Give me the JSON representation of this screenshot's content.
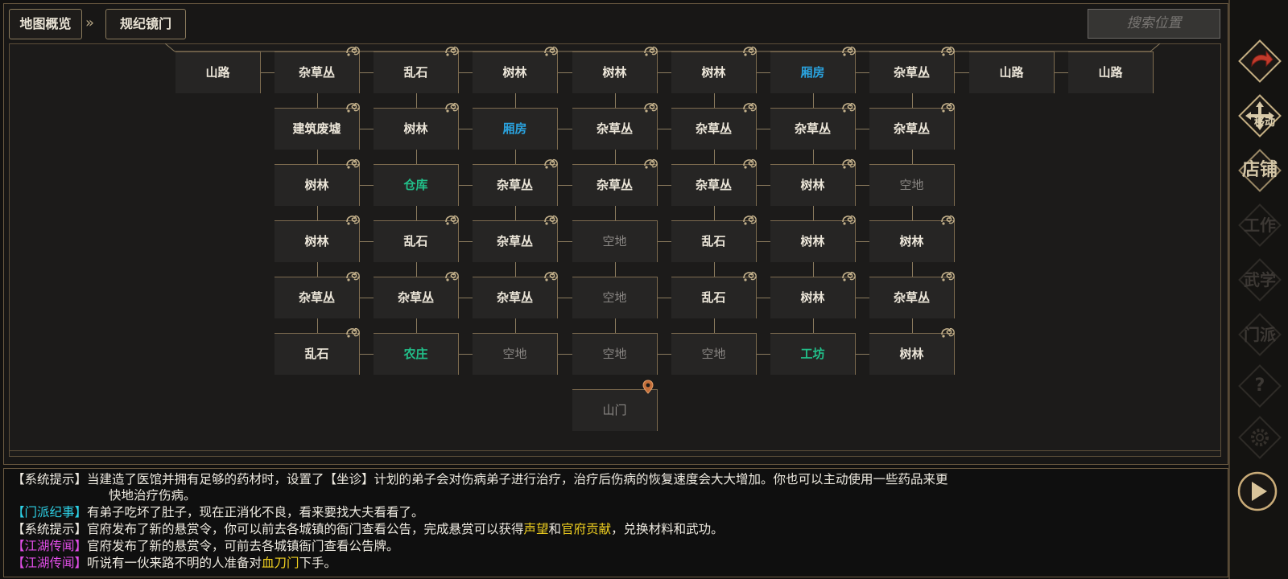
{
  "breadcrumb": {
    "root": "地图概览",
    "separator": "»",
    "current": "规纪镜门"
  },
  "search": {
    "placeholder": "搜索位置"
  },
  "map": {
    "rows": [
      [
        {
          "label": "山路",
          "type": "normal",
          "badge": false
        },
        {
          "label": "杂草丛",
          "type": "normal",
          "badge": true
        },
        {
          "label": "乱石",
          "type": "normal",
          "badge": true
        },
        {
          "label": "树林",
          "type": "normal",
          "badge": true
        },
        {
          "label": "树林",
          "type": "normal",
          "badge": true
        },
        {
          "label": "树林",
          "type": "normal",
          "badge": true
        },
        {
          "label": "厢房",
          "type": "blue",
          "badge": true
        },
        {
          "label": "杂草丛",
          "type": "normal",
          "badge": true
        },
        {
          "label": "山路",
          "type": "normal",
          "badge": false
        },
        {
          "label": "山路",
          "type": "normal",
          "badge": false
        }
      ],
      [
        {
          "label": "建筑废墟",
          "type": "normal",
          "badge": true
        },
        {
          "label": "树林",
          "type": "normal",
          "badge": true
        },
        {
          "label": "厢房",
          "type": "blue",
          "badge": false
        },
        {
          "label": "杂草丛",
          "type": "normal",
          "badge": true
        },
        {
          "label": "杂草丛",
          "type": "normal",
          "badge": true
        },
        {
          "label": "杂草丛",
          "type": "normal",
          "badge": true
        },
        {
          "label": "杂草丛",
          "type": "normal",
          "badge": true
        }
      ],
      [
        {
          "label": "树林",
          "type": "normal",
          "badge": true
        },
        {
          "label": "仓库",
          "type": "green",
          "badge": false
        },
        {
          "label": "杂草丛",
          "type": "normal",
          "badge": true
        },
        {
          "label": "杂草丛",
          "type": "normal",
          "badge": true
        },
        {
          "label": "杂草丛",
          "type": "normal",
          "badge": true
        },
        {
          "label": "树林",
          "type": "normal",
          "badge": true
        },
        {
          "label": "空地",
          "type": "empty",
          "badge": false
        }
      ],
      [
        {
          "label": "树林",
          "type": "normal",
          "badge": true
        },
        {
          "label": "乱石",
          "type": "normal",
          "badge": true
        },
        {
          "label": "杂草丛",
          "type": "normal",
          "badge": true
        },
        {
          "label": "空地",
          "type": "empty",
          "badge": false
        },
        {
          "label": "乱石",
          "type": "normal",
          "badge": true
        },
        {
          "label": "树林",
          "type": "normal",
          "badge": true
        },
        {
          "label": "树林",
          "type": "normal",
          "badge": true
        }
      ],
      [
        {
          "label": "杂草丛",
          "type": "normal",
          "badge": true
        },
        {
          "label": "杂草丛",
          "type": "normal",
          "badge": true
        },
        {
          "label": "杂草丛",
          "type": "normal",
          "badge": true
        },
        {
          "label": "空地",
          "type": "empty",
          "badge": false
        },
        {
          "label": "乱石",
          "type": "normal",
          "badge": true
        },
        {
          "label": "树林",
          "type": "normal",
          "badge": true
        },
        {
          "label": "杂草丛",
          "type": "normal",
          "badge": true
        }
      ],
      [
        {
          "label": "乱石",
          "type": "normal",
          "badge": true
        },
        {
          "label": "农庄",
          "type": "green",
          "badge": false
        },
        {
          "label": "空地",
          "type": "empty",
          "badge": false
        },
        {
          "label": "空地",
          "type": "empty",
          "badge": false
        },
        {
          "label": "空地",
          "type": "empty",
          "badge": false
        },
        {
          "label": "工坊",
          "type": "green",
          "badge": false
        },
        {
          "label": "树林",
          "type": "normal",
          "badge": true
        }
      ],
      [
        {
          "label": "山门",
          "type": "empty",
          "badge": false
        }
      ]
    ]
  },
  "log": {
    "line1_tag": "【系统提示】",
    "line1_text": "当建造了医馆并拥有足够的药材时，设置了【坐诊】计划的弟子会对伤病弟子进行治疗，治疗后伤病的恢复速度会大大增加。你也可以主动使用一些药品来更",
    "line1_cont": "快地治疗伤病。",
    "line2_tag": "【门派纪事】",
    "line2_text": "有弟子吃坏了肚子，现在正消化不良，看来要找大夫看看了。",
    "line3_tag": "【系统提示】",
    "line3_text_a": "官府发布了新的悬赏令，你可以前去各城镇的衙门查看公告，完成悬赏可以获得",
    "line3_hl1": "声望",
    "line3_mid": "和",
    "line3_hl2": "官府贡献",
    "line3_text_b": "，兑换材料和武功。",
    "line4_tag": "【江湖传闻】",
    "line4_text": "官府发布了新的悬赏令，可前去各城镇衙门查看公告牌。",
    "line5_tag": "【江湖传闻】",
    "line5_text_a": "听说有一伙来路不明的人准备对",
    "line5_hl": "血刀门",
    "line5_text_b": "下手。"
  },
  "sidebar": {
    "buttons": [
      {
        "label": "",
        "icon": "return-arrow-icon",
        "enabled": true
      },
      {
        "label": "移动",
        "icon": "move-arrows-icon",
        "enabled": true
      },
      {
        "label": "店铺",
        "icon": "shop-icon",
        "enabled": true
      },
      {
        "label": "工作",
        "icon": "work-icon",
        "enabled": false
      },
      {
        "label": "武学",
        "icon": "martial-arts-icon",
        "enabled": false
      },
      {
        "label": "门派",
        "icon": "sect-icon",
        "enabled": false
      },
      {
        "label": "?",
        "icon": "help-icon",
        "enabled": false
      },
      {
        "label": "",
        "icon": "gear-icon",
        "enabled": false
      }
    ],
    "play_icon": "play-icon"
  },
  "colors": {
    "tile_bg": "#262524",
    "tile_border": "#7e6c50",
    "blue_building": "#2aa3df",
    "green_building": "#22c08a",
    "empty_text": "#8a8784",
    "sect_tag": "#2ed3e8",
    "rumor_tag": "#e24ee8",
    "highlight": "#f0d020"
  }
}
